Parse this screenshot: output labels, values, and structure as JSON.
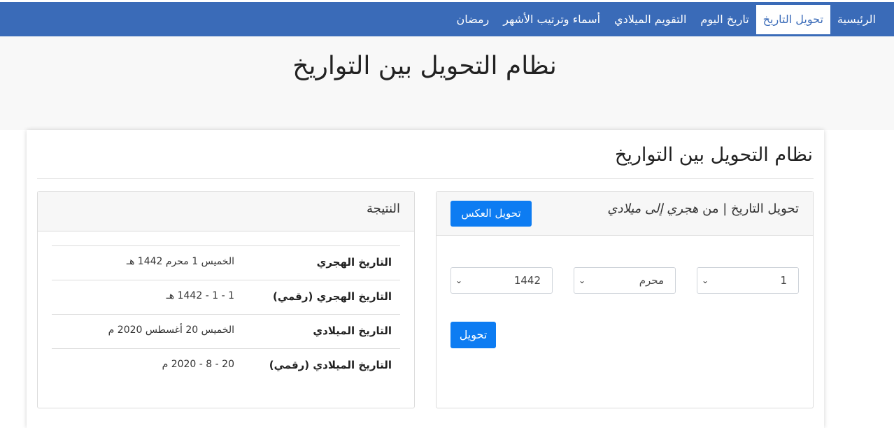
{
  "nav": {
    "items": [
      {
        "label": "الرئيسية",
        "active": false
      },
      {
        "label": "تحويل التاريخ",
        "active": true
      },
      {
        "label": "تاريخ اليوم",
        "active": false
      },
      {
        "label": "التقويم الميلادي",
        "active": false
      },
      {
        "label": "أسماء وترتيب الأشهر",
        "active": false
      },
      {
        "label": "رمضان",
        "active": false
      }
    ]
  },
  "hero": {
    "title": "نظام التحويل بين التواريخ"
  },
  "main": {
    "title": "نظام التحويل بين التواريخ"
  },
  "converter": {
    "title_prefix": "تحويل التاريخ | من",
    "title_direction": "هجري إلى ميلادي",
    "swap_label": "تحويل العكس",
    "day": "1",
    "month": "محرم",
    "year": "1442",
    "submit_label": "تحويل"
  },
  "result": {
    "title": "النتيجة",
    "rows": [
      {
        "label": "التاريخ الهجري",
        "value": "الخميس 1 محرم 1442 هـ"
      },
      {
        "label": "التاريخ الهجري (رقمي)",
        "value": "1 - 1 - 1442 هـ"
      },
      {
        "label": "التاريخ الميلادي",
        "value": "الخميس 20 أغسطس 2020 م"
      },
      {
        "label": "التاريخ الميلادي (رقمي)",
        "value": "20 - 8 - 2020 م"
      }
    ]
  },
  "colors": {
    "navbar": "#3a6bb8",
    "primary_button": "#0d7cf2"
  }
}
